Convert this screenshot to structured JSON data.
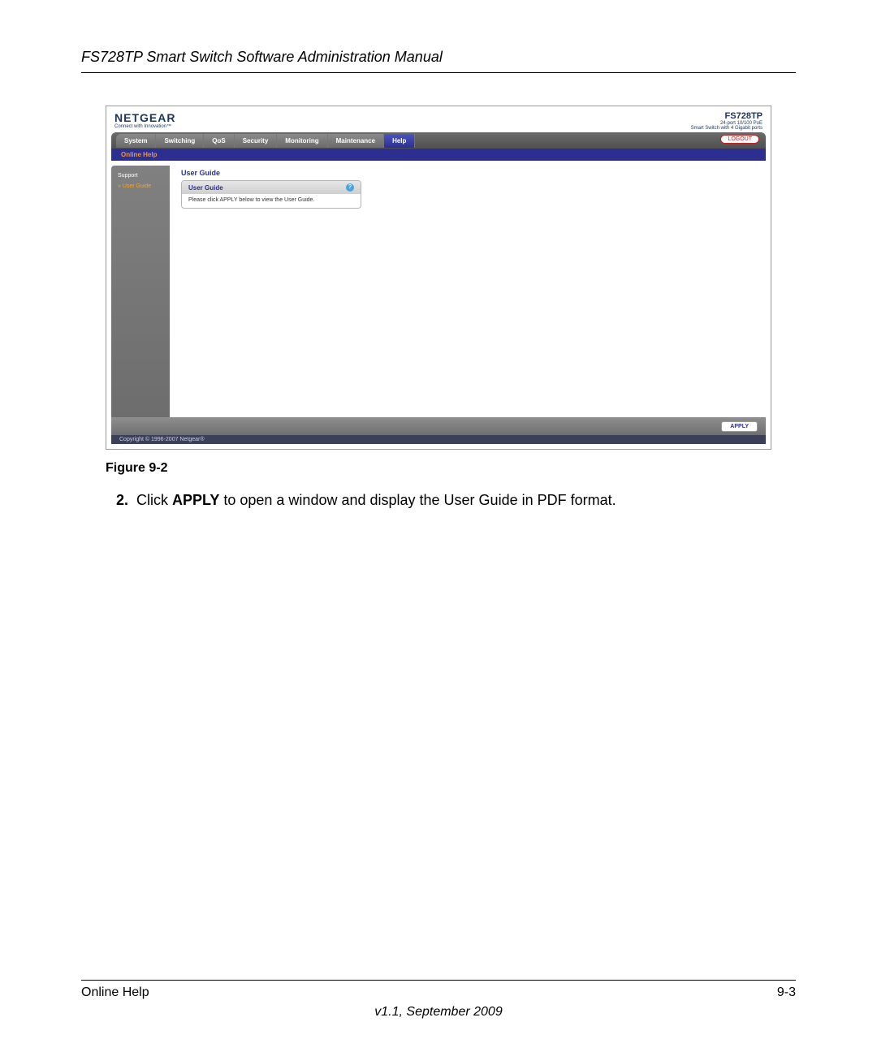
{
  "doc": {
    "header_title": "FS728TP Smart Switch Software Administration Manual",
    "figure_caption": "Figure 9-2",
    "instruction_number": "2.",
    "instruction_prefix": "Click ",
    "instruction_bold": "APPLY",
    "instruction_suffix": " to open a window and display the User Guide in PDF format.",
    "footer_left": "Online Help",
    "footer_right": "9-3",
    "footer_version": "v1.1, September 2009"
  },
  "screenshot": {
    "logo": "NETGEAR",
    "logo_tagline": "Connect with Innovation™",
    "product_name": "FS728TP",
    "product_desc_line1": "24-port 10/100 PoE",
    "product_desc_line2": "Smart Switch with 4 Gigabit ports",
    "tabs": [
      "System",
      "Switching",
      "QoS",
      "Security",
      "Monitoring",
      "Maintenance",
      "Help"
    ],
    "active_tab_index": 6,
    "logout_label": "LOGOUT",
    "subnav": "Online Help",
    "sidebar": {
      "items": [
        "Support",
        "» User Guide"
      ],
      "selected_index": 1
    },
    "panel": {
      "title": "User Guide",
      "box_header": "User Guide",
      "note": "Please click APPLY below to view the User Guide."
    },
    "apply_label": "APPLY",
    "copyright": "Copyright © 1996-2007 Netgear®"
  }
}
